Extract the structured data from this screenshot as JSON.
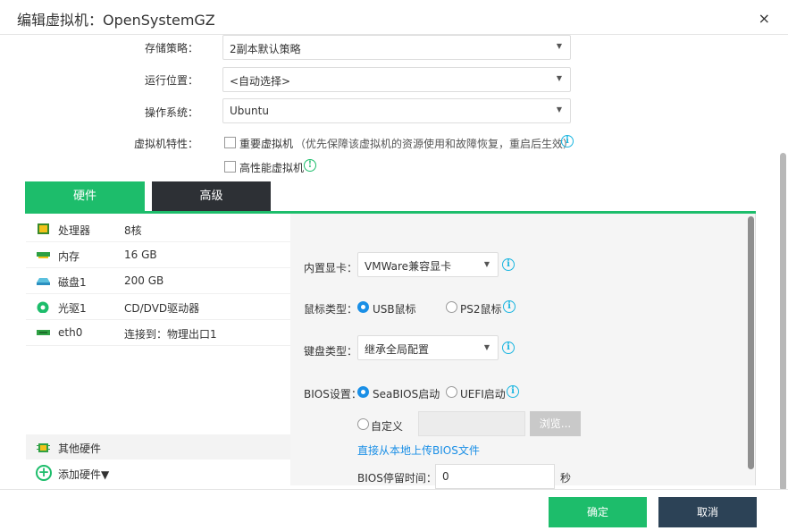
{
  "dialog": {
    "title": "编辑虚拟机：OpenSystemGZ",
    "close_glyph": "×"
  },
  "form": {
    "storage_policy": {
      "label": "存储策略：",
      "value": "2副本默认策略"
    },
    "run_location": {
      "label": "运行位置：",
      "value": "<自动选择>"
    },
    "os": {
      "label": "操作系统：",
      "value": "Ubuntu"
    },
    "vm_features": {
      "label": "虚拟机特性：",
      "important_vm": {
        "label": "重要虚拟机",
        "note": "（优先保障该虚拟机的资源使用和故障恢复，重启后生效）",
        "checked": false
      },
      "high_perf_vm": {
        "label": "高性能虚拟机",
        "checked": false
      }
    }
  },
  "tabs": [
    {
      "label": "硬件",
      "active": true
    },
    {
      "label": "高级",
      "active": false
    }
  ],
  "hardware": {
    "items": [
      {
        "name": "处理器",
        "value": "8核",
        "icon": "cpu-icon"
      },
      {
        "name": "内存",
        "value": "16 GB",
        "icon": "memory-icon"
      },
      {
        "name": "磁盘1",
        "value": "200 GB",
        "icon": "disk-icon"
      },
      {
        "name": "光驱1",
        "value": "CD/DVD驱动器",
        "icon": "optical-drive-icon"
      },
      {
        "name": "eth0",
        "value": "连接到：物理出口1",
        "icon": "network-icon"
      }
    ],
    "other": {
      "label": "其他硬件",
      "icon": "other-hardware-icon"
    },
    "add": {
      "label": "添加硬件▼",
      "icon": "add-circle-icon"
    }
  },
  "details": {
    "graphics": {
      "label": "内置显卡：",
      "value": "VMWare兼容显卡"
    },
    "mouse": {
      "label": "鼠标类型：",
      "options": [
        "USB鼠标",
        "PS2鼠标"
      ],
      "selected": "USB鼠标"
    },
    "keyboard": {
      "label": "键盘类型：",
      "value": "继承全局配置"
    },
    "bios": {
      "label": "BIOS设置：",
      "options": [
        "SeaBIOS启动",
        "UEFI启动"
      ],
      "selected": "SeaBIOS启动",
      "custom_label": "自定义",
      "browse_label": "浏览...",
      "upload_link": "直接从本地上传BIOS文件",
      "delay_label": "BIOS停留时间：",
      "delay_value": "0",
      "delay_unit": "秒"
    }
  },
  "footer": {
    "ok_label": "确定",
    "cancel_label": "取消"
  },
  "colors": {
    "accent_green": "#1dbd6b",
    "dark": "#2d3035",
    "cancel_bg": "#2c4256",
    "link_blue": "#1a8fe6",
    "info_blue": "#19b5e0"
  }
}
